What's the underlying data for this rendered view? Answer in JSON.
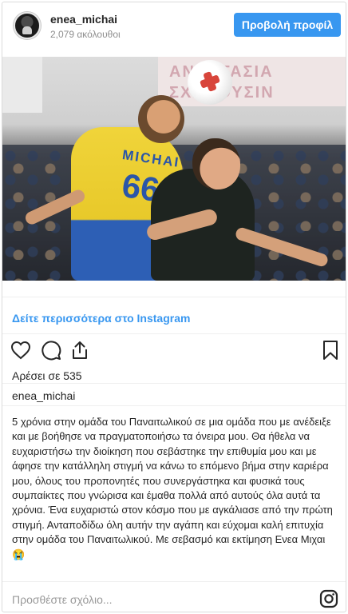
{
  "header": {
    "username": "enea_michai",
    "followers": "2,079 ακόλουθοι",
    "view_profile_label": "Προβολή προφίλ"
  },
  "photo": {
    "banner_text_1": "ΑΝΑΣΤΑΣΙΑ",
    "banner_text_2": "ΣΧΑΚΟΥΣΙΝ",
    "jersey_name": "MICHAI",
    "jersey_number": "66"
  },
  "see_more_label": "Δείτε περισσότερα στο Instagram",
  "actions": {
    "like_icon": "heart-icon",
    "comment_icon": "comment-icon",
    "share_icon": "share-icon",
    "save_icon": "bookmark-icon"
  },
  "likes": "Αρέσει σε 535",
  "author": "enea_michai",
  "caption": "5 χρόνια στην ομάδα του Παναιτωλικού σε μια ομάδα που με ανέδειξε και με βοήθησε να πραγματοποιήσω τα όνειρα μου. Θα ήθελα να ευχαριστήσω την διοίκηση που σεβάστηκε την επιθυμία μου και με άφησε την κατάλληλη στιγμή να κάνω το επόμενο βήμα στην καριέρα μου, όλους του προπονητές που συνεργάστηκα και φυσικά τους συμπαίκτες που γνώρισα και έμαθα πολλά από αυτούς όλα αυτά τα χρόνια. Ένα ευχαριστώ στον κόσμο που με αγκάλιασε από την πρώτη στιγμή. Ανταποδίδω όλη αυτήν την αγάπη και εύχομαι καλή επιτυχία στην ομάδα του Παναιτωλικού. Με σεβασμό και εκτίμηση Ενεα Μιχαι 😭",
  "comment": {
    "placeholder": "Προσθέστε σχόλιο..."
  },
  "colors": {
    "accent": "#3897f0",
    "text": "#262626",
    "muted": "#8e8e8e"
  }
}
